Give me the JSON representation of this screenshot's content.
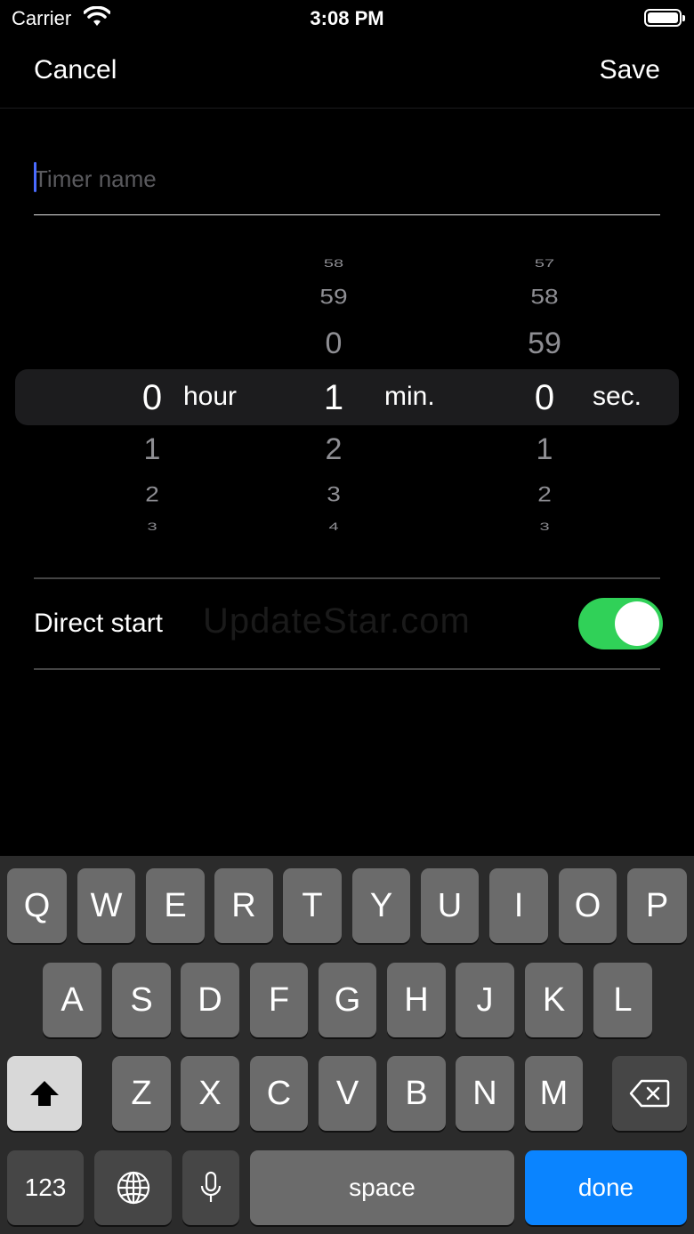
{
  "status_bar": {
    "carrier": "Carrier",
    "time": "3:08 PM"
  },
  "nav": {
    "cancel": "Cancel",
    "save": "Save"
  },
  "name_field": {
    "placeholder": "Timer name",
    "value": ""
  },
  "picker": {
    "hours": {
      "above": [],
      "selected": "0",
      "below": [
        "1",
        "2",
        "3"
      ],
      "unit": "hour"
    },
    "minutes": {
      "above": [
        "58",
        "59",
        "0"
      ],
      "selected": "1",
      "below": [
        "2",
        "3",
        "4"
      ],
      "unit": "min."
    },
    "seconds": {
      "above": [
        "57",
        "58",
        "59"
      ],
      "selected": "0",
      "below": [
        "1",
        "2",
        "3"
      ],
      "unit": "sec."
    }
  },
  "direct_start": {
    "label": "Direct start",
    "enabled": true,
    "toggle_color": "#30d158"
  },
  "watermark": "UpdateStar.com",
  "keyboard": {
    "row1": [
      "Q",
      "W",
      "E",
      "R",
      "T",
      "Y",
      "U",
      "I",
      "O",
      "P"
    ],
    "row2": [
      "A",
      "S",
      "D",
      "F",
      "G",
      "H",
      "J",
      "K",
      "L"
    ],
    "row3": [
      "Z",
      "X",
      "C",
      "V",
      "B",
      "N",
      "M"
    ],
    "numbers_label": "123",
    "space_label": "space",
    "done_label": "done",
    "done_color": "#0a84ff"
  }
}
